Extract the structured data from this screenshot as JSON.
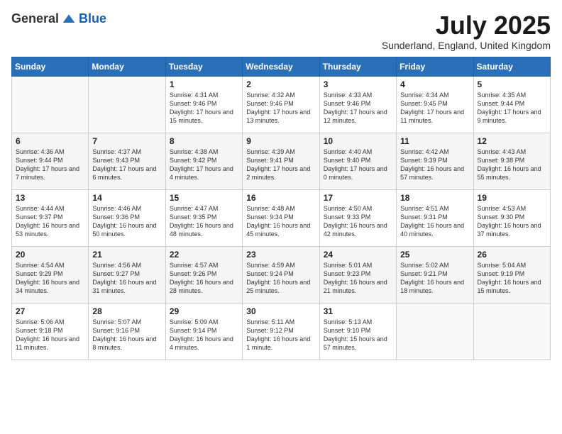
{
  "header": {
    "logo_general": "General",
    "logo_blue": "Blue",
    "month": "July 2025",
    "location": "Sunderland, England, United Kingdom"
  },
  "days_of_week": [
    "Sunday",
    "Monday",
    "Tuesday",
    "Wednesday",
    "Thursday",
    "Friday",
    "Saturday"
  ],
  "weeks": [
    [
      {
        "day": "",
        "info": ""
      },
      {
        "day": "",
        "info": ""
      },
      {
        "day": "1",
        "info": "Sunrise: 4:31 AM\nSunset: 9:46 PM\nDaylight: 17 hours and 15 minutes."
      },
      {
        "day": "2",
        "info": "Sunrise: 4:32 AM\nSunset: 9:46 PM\nDaylight: 17 hours and 13 minutes."
      },
      {
        "day": "3",
        "info": "Sunrise: 4:33 AM\nSunset: 9:46 PM\nDaylight: 17 hours and 12 minutes."
      },
      {
        "day": "4",
        "info": "Sunrise: 4:34 AM\nSunset: 9:45 PM\nDaylight: 17 hours and 11 minutes."
      },
      {
        "day": "5",
        "info": "Sunrise: 4:35 AM\nSunset: 9:44 PM\nDaylight: 17 hours and 9 minutes."
      }
    ],
    [
      {
        "day": "6",
        "info": "Sunrise: 4:36 AM\nSunset: 9:44 PM\nDaylight: 17 hours and 7 minutes."
      },
      {
        "day": "7",
        "info": "Sunrise: 4:37 AM\nSunset: 9:43 PM\nDaylight: 17 hours and 6 minutes."
      },
      {
        "day": "8",
        "info": "Sunrise: 4:38 AM\nSunset: 9:42 PM\nDaylight: 17 hours and 4 minutes."
      },
      {
        "day": "9",
        "info": "Sunrise: 4:39 AM\nSunset: 9:41 PM\nDaylight: 17 hours and 2 minutes."
      },
      {
        "day": "10",
        "info": "Sunrise: 4:40 AM\nSunset: 9:40 PM\nDaylight: 17 hours and 0 minutes."
      },
      {
        "day": "11",
        "info": "Sunrise: 4:42 AM\nSunset: 9:39 PM\nDaylight: 16 hours and 57 minutes."
      },
      {
        "day": "12",
        "info": "Sunrise: 4:43 AM\nSunset: 9:38 PM\nDaylight: 16 hours and 55 minutes."
      }
    ],
    [
      {
        "day": "13",
        "info": "Sunrise: 4:44 AM\nSunset: 9:37 PM\nDaylight: 16 hours and 53 minutes."
      },
      {
        "day": "14",
        "info": "Sunrise: 4:46 AM\nSunset: 9:36 PM\nDaylight: 16 hours and 50 minutes."
      },
      {
        "day": "15",
        "info": "Sunrise: 4:47 AM\nSunset: 9:35 PM\nDaylight: 16 hours and 48 minutes."
      },
      {
        "day": "16",
        "info": "Sunrise: 4:48 AM\nSunset: 9:34 PM\nDaylight: 16 hours and 45 minutes."
      },
      {
        "day": "17",
        "info": "Sunrise: 4:50 AM\nSunset: 9:33 PM\nDaylight: 16 hours and 42 minutes."
      },
      {
        "day": "18",
        "info": "Sunrise: 4:51 AM\nSunset: 9:31 PM\nDaylight: 16 hours and 40 minutes."
      },
      {
        "day": "19",
        "info": "Sunrise: 4:53 AM\nSunset: 9:30 PM\nDaylight: 16 hours and 37 minutes."
      }
    ],
    [
      {
        "day": "20",
        "info": "Sunrise: 4:54 AM\nSunset: 9:29 PM\nDaylight: 16 hours and 34 minutes."
      },
      {
        "day": "21",
        "info": "Sunrise: 4:56 AM\nSunset: 9:27 PM\nDaylight: 16 hours and 31 minutes."
      },
      {
        "day": "22",
        "info": "Sunrise: 4:57 AM\nSunset: 9:26 PM\nDaylight: 16 hours and 28 minutes."
      },
      {
        "day": "23",
        "info": "Sunrise: 4:59 AM\nSunset: 9:24 PM\nDaylight: 16 hours and 25 minutes."
      },
      {
        "day": "24",
        "info": "Sunrise: 5:01 AM\nSunset: 9:23 PM\nDaylight: 16 hours and 21 minutes."
      },
      {
        "day": "25",
        "info": "Sunrise: 5:02 AM\nSunset: 9:21 PM\nDaylight: 16 hours and 18 minutes."
      },
      {
        "day": "26",
        "info": "Sunrise: 5:04 AM\nSunset: 9:19 PM\nDaylight: 16 hours and 15 minutes."
      }
    ],
    [
      {
        "day": "27",
        "info": "Sunrise: 5:06 AM\nSunset: 9:18 PM\nDaylight: 16 hours and 11 minutes."
      },
      {
        "day": "28",
        "info": "Sunrise: 5:07 AM\nSunset: 9:16 PM\nDaylight: 16 hours and 8 minutes."
      },
      {
        "day": "29",
        "info": "Sunrise: 5:09 AM\nSunset: 9:14 PM\nDaylight: 16 hours and 4 minutes."
      },
      {
        "day": "30",
        "info": "Sunrise: 5:11 AM\nSunset: 9:12 PM\nDaylight: 16 hours and 1 minute."
      },
      {
        "day": "31",
        "info": "Sunrise: 5:13 AM\nSunset: 9:10 PM\nDaylight: 15 hours and 57 minutes."
      },
      {
        "day": "",
        "info": ""
      },
      {
        "day": "",
        "info": ""
      }
    ]
  ]
}
